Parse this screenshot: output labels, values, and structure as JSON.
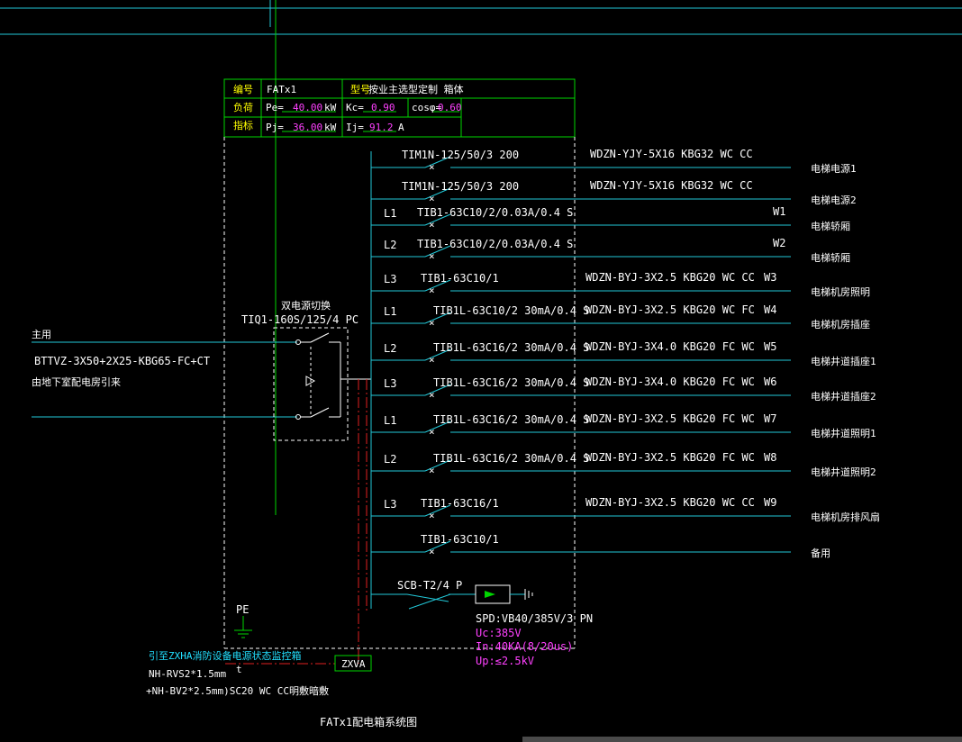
{
  "header": {
    "id_label": "编号",
    "id_value": "FATx1",
    "model_label": "型号",
    "model_value": "按业主选型定制 箱体",
    "load_label_1": "负荷",
    "load_label_2": "指标",
    "pe_label": "Pe=",
    "pe_value": "40.00",
    "pe_unit": "kW",
    "kc_label": "Kc=",
    "kc_value": "0.90",
    "cos_label": "cosφ=",
    "cos_value": "0.60",
    "pj_label": "Pj=",
    "pj_value": "36.00",
    "pj_unit": "kW",
    "ij_label": "Ij=",
    "ij_value": "91.2",
    "ij_unit": "A"
  },
  "incoming": {
    "source_label": "主用",
    "cable": "BTTVZ-3X50+2X25-KBG65-FC+CT",
    "from_text": "由地下室配电房引来",
    "ats_label": "双电源切换",
    "ats_model": "TIQ1-160S/125/4 PC"
  },
  "circuits": [
    {
      "phase": "",
      "breaker": "TIM1N-125/50/3 200",
      "cable": "WDZN-YJY-5X16  KBG32  WC CC",
      "num": "",
      "load": "电梯电源1"
    },
    {
      "phase": "",
      "breaker": "TIM1N-125/50/3 200",
      "cable": "WDZN-YJY-5X16  KBG32  WC CC",
      "num": "",
      "load": "电梯电源2"
    },
    {
      "phase": "L1",
      "breaker": "TIB1-63C10/2/0.03A/0.4 S",
      "cable": "",
      "num": "W1",
      "load": "电梯轿厢"
    },
    {
      "phase": "L2",
      "breaker": "TIB1-63C10/2/0.03A/0.4 S",
      "cable": "",
      "num": "W2",
      "load": "电梯轿厢"
    },
    {
      "phase": "L3",
      "breaker": "TIB1-63C10/1",
      "cable": "WDZN-BYJ-3X2.5  KBG20  WC CC",
      "num": "W3",
      "load": "电梯机房照明"
    },
    {
      "phase": "L1",
      "breaker": "TIB1L-63C10/2 30mA/0.4 S",
      "cable": "WDZN-BYJ-3X2.5  KBG20  WC FC",
      "num": "W4",
      "load": "电梯机房插座"
    },
    {
      "phase": "L2",
      "breaker": "TIB1L-63C16/2 30mA/0.4 S",
      "cable": "WDZN-BYJ-3X4.0  KBG20  FC WC",
      "num": "W5",
      "load": "电梯井道插座1"
    },
    {
      "phase": "L3",
      "breaker": "TIB1L-63C16/2 30mA/0.4 S",
      "cable": "WDZN-BYJ-3X4.0  KBG20  FC WC",
      "num": "W6",
      "load": "电梯井道插座2"
    },
    {
      "phase": "L1",
      "breaker": "TIB1L-63C16/2 30mA/0.4 S",
      "cable": "WDZN-BYJ-3X2.5  KBG20  FC WC",
      "num": "W7",
      "load": "电梯井道照明1"
    },
    {
      "phase": "L2",
      "breaker": "TIB1L-63C16/2 30mA/0.4 S",
      "cable": "WDZN-BYJ-3X2.5  KBG20  FC WC",
      "num": "W8",
      "load": "电梯井道照明2"
    },
    {
      "phase": "L3",
      "breaker": "TIB1-63C16/1",
      "cable": "WDZN-BYJ-3X2.5  KBG20  WC CC",
      "num": "W9",
      "load": "电梯机房排风扇"
    },
    {
      "phase": "",
      "breaker": "TIB1-63C10/1",
      "cable": "",
      "num": "",
      "load": "备用"
    }
  ],
  "spd": {
    "breaker": "SCB-T2/4 P",
    "model": "SPD:VB40/385V/3 PN",
    "uc": "Uc:385V",
    "in": "In:40KA(8/20us)",
    "up": "Up:≤2.5kV"
  },
  "pe_label": "PE",
  "fire": {
    "note": "引至ZXHA消防设备电源状态监控箱",
    "box": "ZXVA",
    "cable1": "NH-RVS2*1.5mm",
    "cable2": "+NH-BV2*2.5mm)SC20 WC CC明敷暗敷",
    "mark": "t"
  },
  "title": "FATx1配电箱系统图",
  "colors": {
    "green": "#00d600",
    "cyan": "#22c8d8",
    "red": "#e02020",
    "yellow": "#ffff00",
    "magenta": "#ff40ff"
  }
}
